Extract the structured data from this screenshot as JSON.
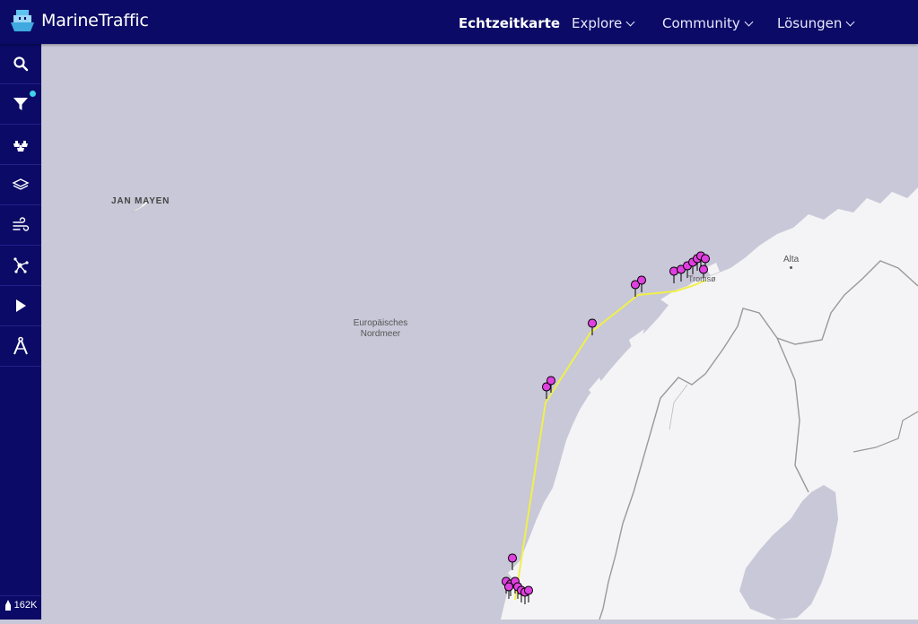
{
  "header": {
    "brand": "MarineTraffic",
    "nav": [
      {
        "label": "Echtzeitkarte",
        "active": true
      },
      {
        "label": "Explore"
      },
      {
        "label": "Community"
      },
      {
        "label": "Lösungen"
      }
    ]
  },
  "sidebar": {
    "items": [
      {
        "icon": "search-icon"
      },
      {
        "icon": "filter-icon",
        "notification": true
      },
      {
        "icon": "fleet-icon"
      },
      {
        "icon": "layers-icon"
      },
      {
        "icon": "wind-icon"
      },
      {
        "icon": "graph-icon"
      },
      {
        "icon": "play-icon"
      },
      {
        "icon": "compass-icon"
      }
    ],
    "vessel_count": "162K"
  },
  "map": {
    "labels": {
      "jan_mayen": "JAN MAYEN",
      "sea_line1": "Europäisches",
      "sea_line2": "Nordmeer",
      "alta": "Alta",
      "tromso": "Tromsø"
    },
    "colors": {
      "water": "#c8c8d8",
      "land": "#f4f4f6",
      "border": "#999999",
      "track": "#f0f04a",
      "marker": "#e040e0"
    }
  }
}
